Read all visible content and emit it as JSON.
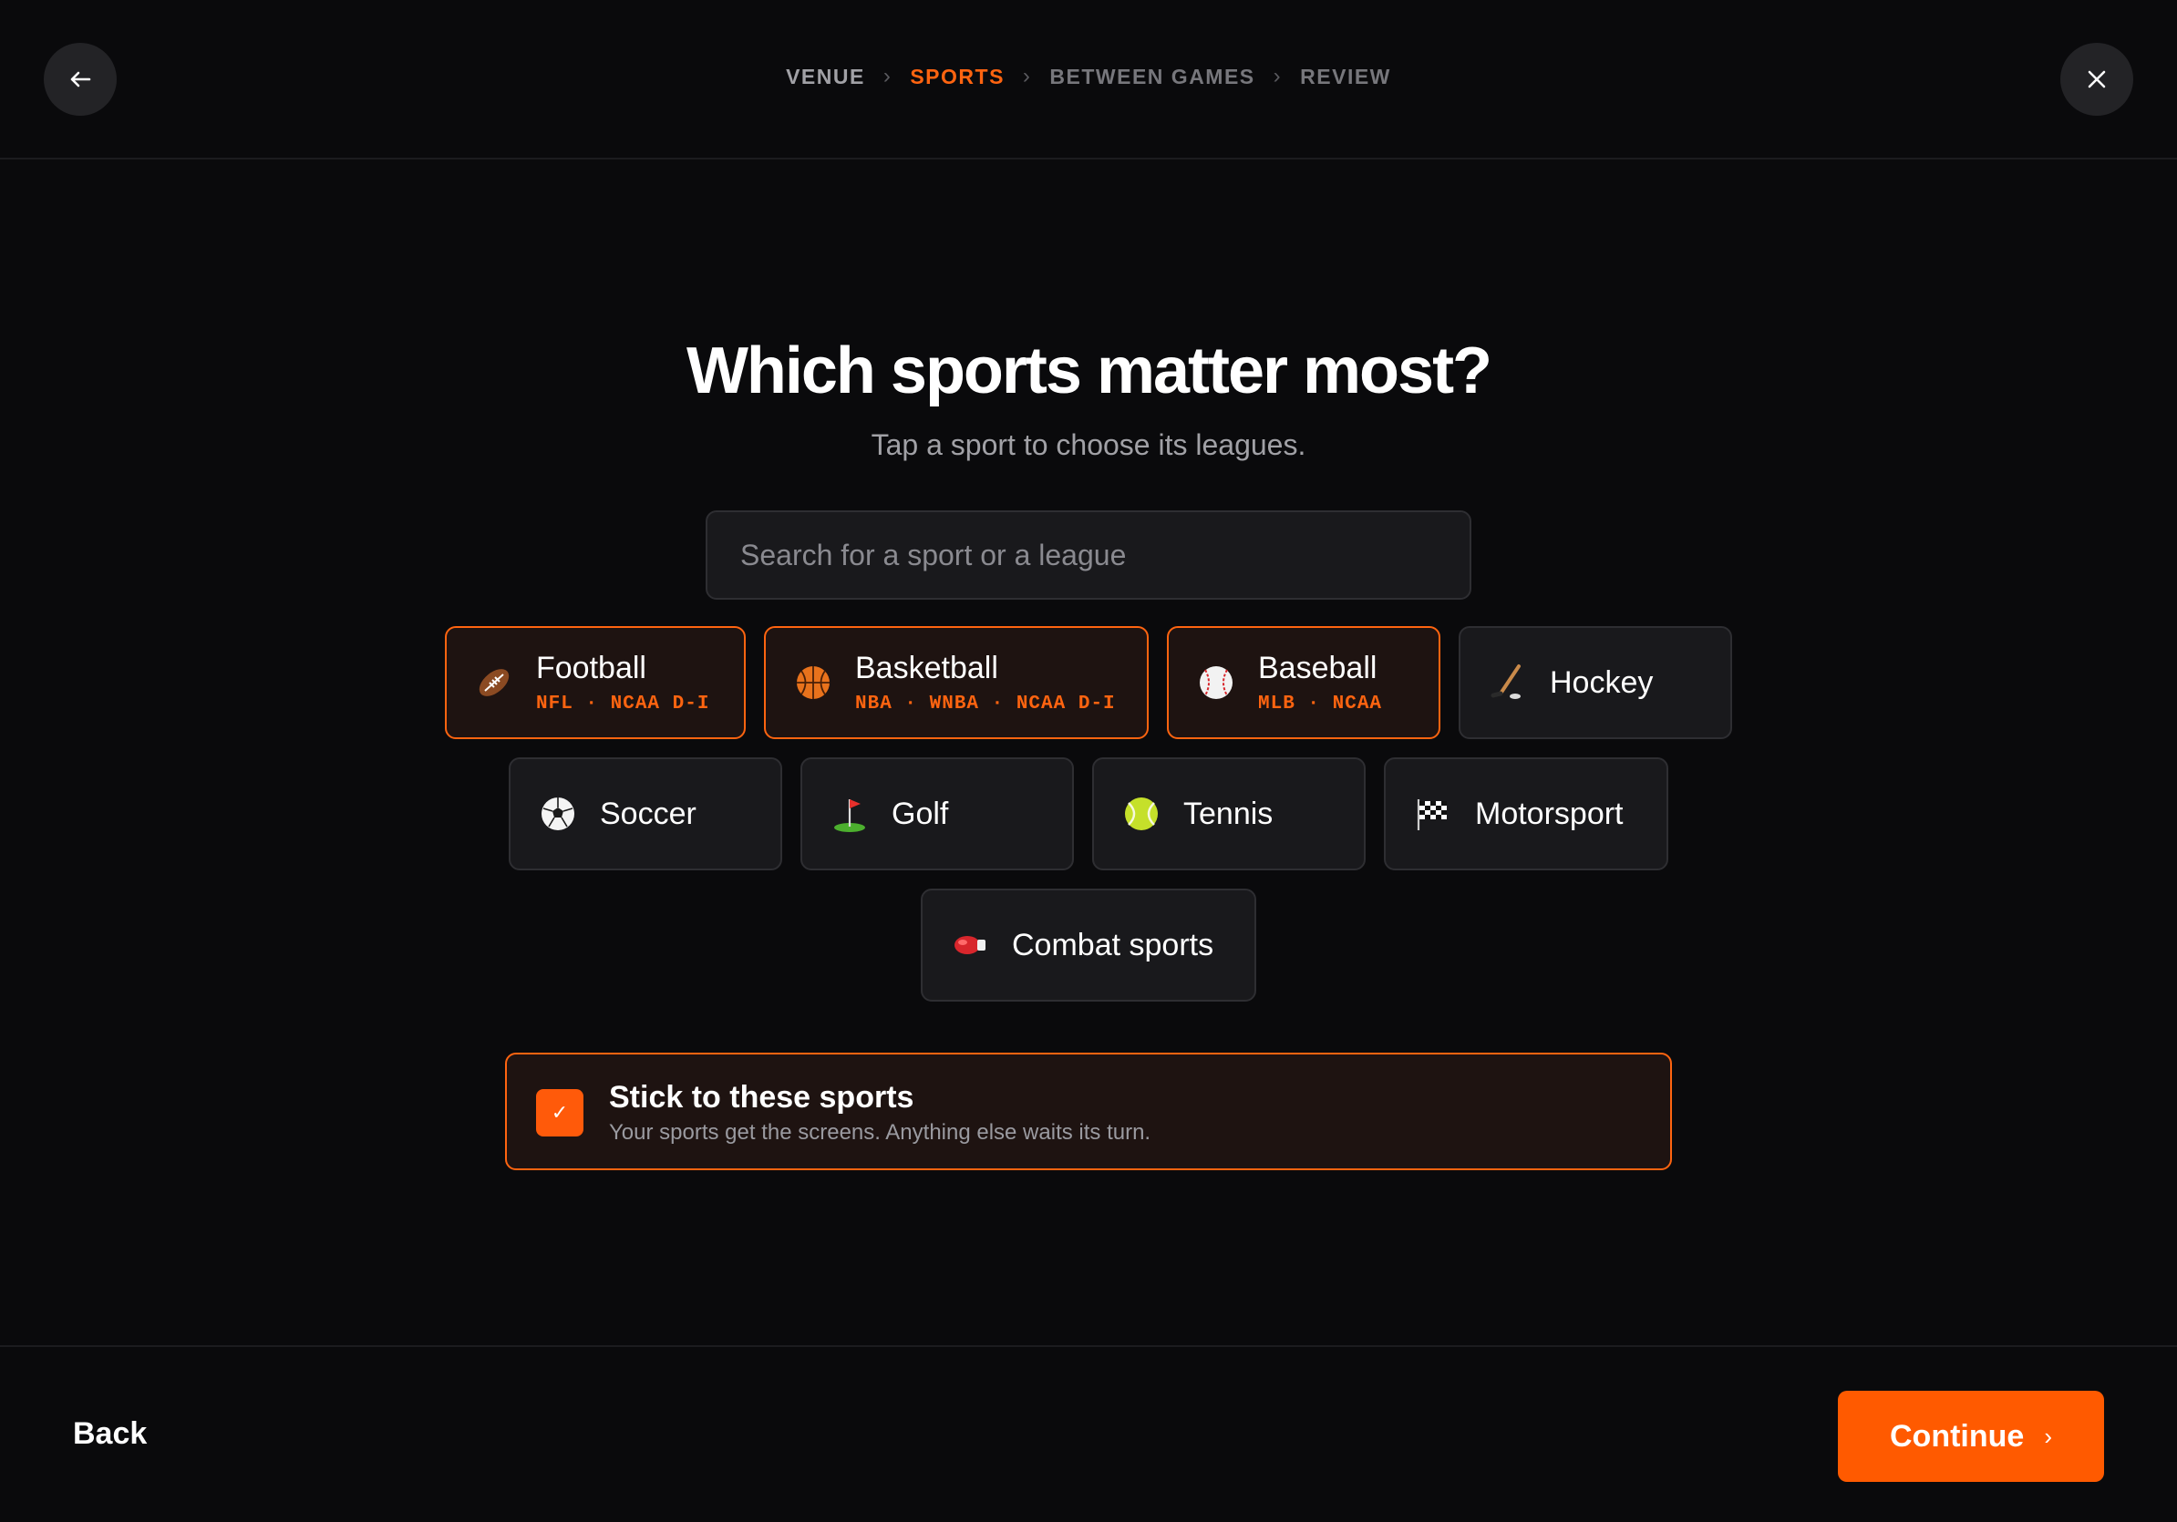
{
  "header": {
    "back_icon": "arrow-left-icon",
    "close_icon": "close-icon",
    "steps": [
      {
        "label": "VENUE",
        "state": "done"
      },
      {
        "label": "SPORTS",
        "state": "active"
      },
      {
        "label": "BETWEEN GAMES",
        "state": "upcoming"
      },
      {
        "label": "REVIEW",
        "state": "upcoming"
      }
    ],
    "separator": "›"
  },
  "main": {
    "title": "Which sports matter most?",
    "subtitle": "Tap a sport to choose its leagues.",
    "search": {
      "placeholder": "Search for a sport or a league",
      "value": ""
    },
    "sports": [
      {
        "name": "Football",
        "icon": "football-icon",
        "leagues": "NFL · NCAA D-I",
        "selected": true
      },
      {
        "name": "Basketball",
        "icon": "basketball-icon",
        "leagues": "NBA · WNBA · NCAA D-I",
        "selected": true
      },
      {
        "name": "Baseball",
        "icon": "baseball-icon",
        "leagues": "MLB · NCAA",
        "selected": true
      },
      {
        "name": "Hockey",
        "icon": "hockey-stick-icon",
        "leagues": "",
        "selected": false
      },
      {
        "name": "Soccer",
        "icon": "soccer-ball-icon",
        "leagues": "",
        "selected": false
      },
      {
        "name": "Golf",
        "icon": "golf-flag-icon",
        "leagues": "",
        "selected": false
      },
      {
        "name": "Tennis",
        "icon": "tennis-ball-icon",
        "leagues": "",
        "selected": false
      },
      {
        "name": "Motorsport",
        "icon": "checkered-flag-icon",
        "leagues": "",
        "selected": false
      },
      {
        "name": "Combat sports",
        "icon": "boxing-glove-icon",
        "leagues": "",
        "selected": false
      }
    ],
    "stick": {
      "checked": true,
      "check_glyph": "✓",
      "title": "Stick to these sports",
      "description": "Your sports get the screens. Anything else waits its turn."
    }
  },
  "footer": {
    "back_label": "Back",
    "continue_label": "Continue",
    "continue_chevron": "›"
  },
  "colors": {
    "accent": "#ff5a00",
    "background": "#0a0a0c",
    "chip_background": "#19191c",
    "selected_chip_background": "#1e1311"
  }
}
